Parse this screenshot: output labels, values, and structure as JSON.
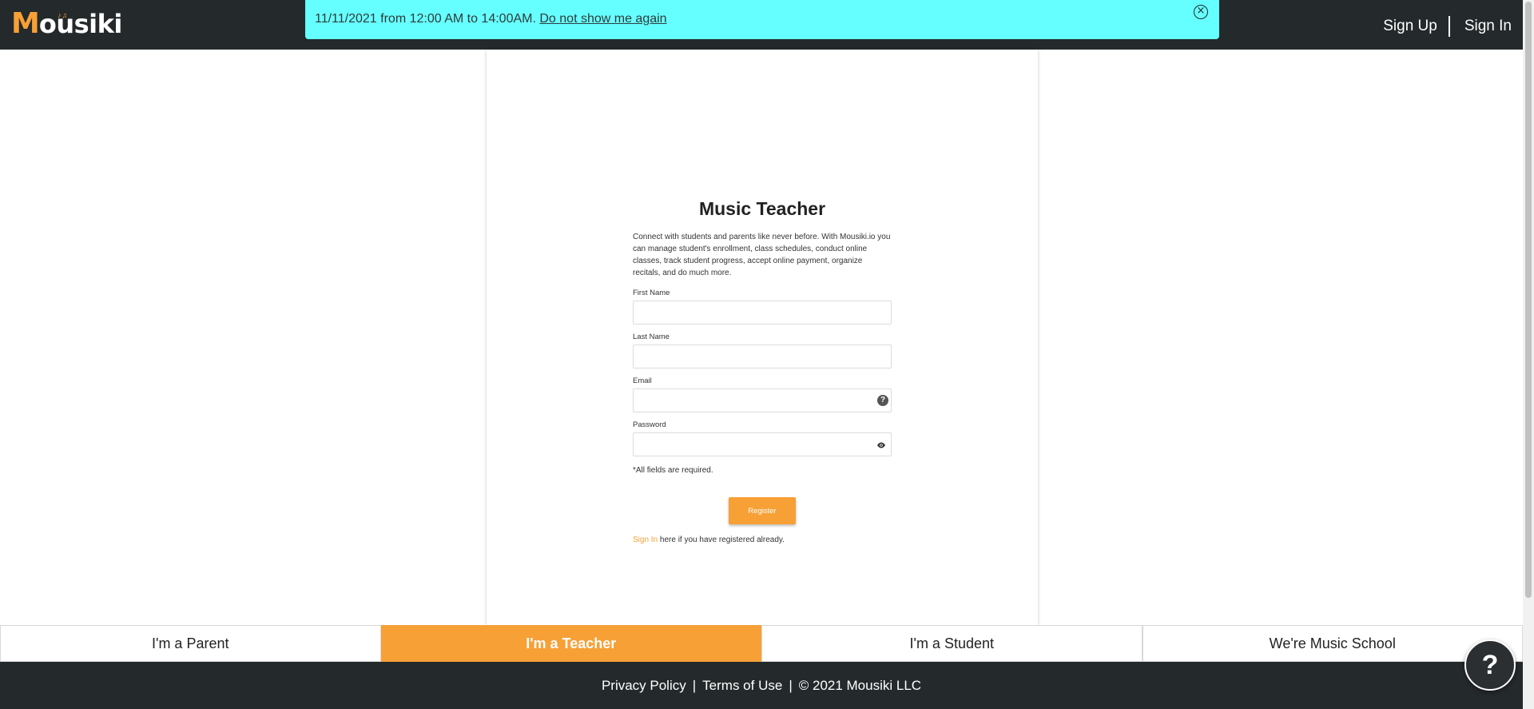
{
  "header": {
    "logo_text_m": "M",
    "logo_text_rest": "ousiki",
    "sign_up": "Sign Up",
    "sign_in": "Sign In"
  },
  "banner": {
    "message": "11/11/2021 from 12:00 AM to 14:00AM.",
    "dismiss_label": "Do not show me again",
    "close_icon": "close-circle-icon"
  },
  "form": {
    "title": "Music Teacher",
    "description": "Connect with students and parents like never before. With Mousiki.io you can manage student's enrollment, class schedules, conduct online classes, track student progress, accept online payment, organize recitals, and do much more.",
    "first_name_label": "First Name",
    "first_name_value": "",
    "last_name_label": "Last Name",
    "last_name_value": "",
    "email_label": "Email",
    "email_value": "",
    "email_help_icon": "question-circle-icon",
    "password_label": "Password",
    "password_value": "",
    "password_toggle_icon": "eye-icon",
    "required_note": "*All fields are required.",
    "register_label": "Register",
    "sign_in_link": "Sign In",
    "sign_in_suffix": " here if you have registered already."
  },
  "roles": [
    {
      "label": "I'm a Parent",
      "active": false
    },
    {
      "label": "I'm a Teacher",
      "active": true
    },
    {
      "label": "I'm a Student",
      "active": false
    },
    {
      "label": "We're Music School",
      "active": false
    }
  ],
  "footer": {
    "privacy": "Privacy Policy",
    "terms": "Terms of Use",
    "copyright": "© 2021 Mousiki LLC",
    "separator": "|"
  },
  "help_bubble": {
    "label": "?"
  },
  "colors": {
    "accent": "#f7a036",
    "header_bg": "#24292b",
    "banner_bg": "#66ffff"
  }
}
